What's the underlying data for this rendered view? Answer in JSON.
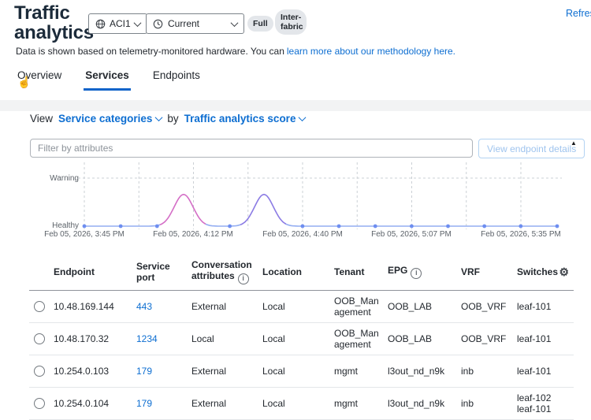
{
  "colors": {
    "link_blue": "#0d6ed1",
    "title": "#1c2b3a",
    "text": "#23282e",
    "tab_underline": "#1164c9"
  },
  "icons": {
    "info": "i",
    "gear": "⚙",
    "cursor": "☝",
    "scroll_up": "▲"
  },
  "header": {
    "title": "Traffic analytics",
    "fabric_selector": "ACI1",
    "time_selector": "Current",
    "badge_full": "Full",
    "badge_interfabric": "Inter-fabric",
    "refresh": "Refresh",
    "subtitle_text": "Data is shown based on telemetry-monitored hardware. You can",
    "subtitle_link": "learn more about our methodology here."
  },
  "tabs": [
    {
      "label": "Overview"
    },
    {
      "label": "Services"
    },
    {
      "label": "Endpoints"
    }
  ],
  "controls": {
    "view_label": "View",
    "view_value": "Service categories",
    "by_label": "by",
    "by_value": "Traffic analytics score",
    "filter_placeholder": "Filter by attributes",
    "details_button": "View endpoint details"
  },
  "chart_data": {
    "type": "line",
    "series_name": "Traffic analytics score",
    "y_labels": [
      "Warning",
      "Healthy"
    ],
    "baseline_level": "Healthy",
    "x_tick_labels": [
      "Feb 05, 2026, 3:45 PM",
      "Feb 05, 2026, 4:12 PM",
      "Feb 05, 2026, 4:40 PM",
      "Feb 05, 2026, 5:07 PM",
      "Feb 05, 2026, 5:35 PM"
    ],
    "num_points": 14,
    "anomalies": [
      {
        "at_fraction": 0.21,
        "approx_time": "4:10 PM",
        "peak": 0.66,
        "color": "#d46ec6"
      },
      {
        "at_fraction": 0.38,
        "approx_time": "4:30 PM",
        "peak": 0.66,
        "color": "#8b7be4"
      }
    ],
    "line_color": "#94aef2",
    "dot_color": "#6e8ef0",
    "grid_color": "#cbd0d5"
  },
  "table": {
    "columns": {
      "endpoint": "Endpoint",
      "service_port": "Service port",
      "conversation_attributes": "Conversation attributes",
      "location": "Location",
      "tenant": "Tenant",
      "epg": "EPG",
      "vrf": "VRF",
      "switches": "Switches"
    },
    "rows": [
      {
        "endpoint": "10.48.169.144",
        "service_port": "443",
        "conversation_attributes": "External",
        "location": "Local",
        "tenant": "OOB_Management",
        "epg": "OOB_LAB",
        "vrf": "OOB_VRF",
        "switches": "leaf-101"
      },
      {
        "endpoint": "10.48.170.32",
        "service_port": "1234",
        "conversation_attributes": "Local",
        "location": "Local",
        "tenant": "OOB_Management",
        "epg": "OOB_LAB",
        "vrf": "OOB_VRF",
        "switches": "leaf-101"
      },
      {
        "endpoint": "10.254.0.103",
        "service_port": "179",
        "conversation_attributes": "External",
        "location": "Local",
        "tenant": "mgmt",
        "epg": "l3out_nd_n9k",
        "vrf": "inb",
        "switches": "leaf-101"
      },
      {
        "endpoint": "10.254.0.104",
        "service_port": "179",
        "conversation_attributes": "External",
        "location": "Local",
        "tenant": "mgmt",
        "epg": "l3out_nd_n9k",
        "vrf": "inb",
        "switches": "leaf-102 leaf-101"
      }
    ]
  }
}
